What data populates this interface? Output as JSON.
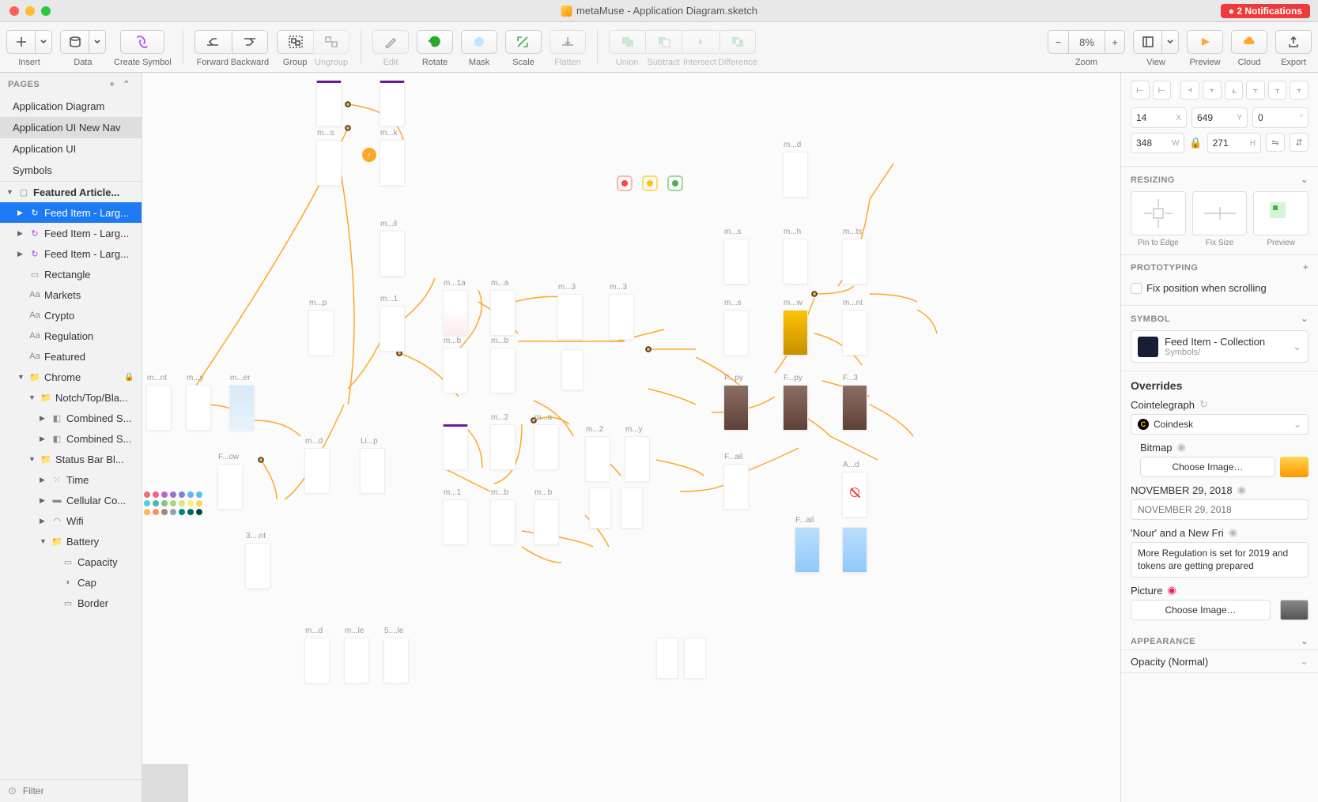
{
  "titlebar": {
    "filename": "metaMuse - Application Diagram.sketch",
    "notifications": "2 Notifications"
  },
  "toolbar": {
    "insert": "Insert",
    "data": "Data",
    "create_symbol": "Create Symbol",
    "forward": "Forward",
    "backward": "Backward",
    "group": "Group",
    "ungroup": "Ungroup",
    "edit": "Edit",
    "rotate": "Rotate",
    "mask": "Mask",
    "scale": "Scale",
    "flatten": "Flatten",
    "union": "Union",
    "subtract": "Subtract",
    "intersect": "Intersect",
    "difference": "Difference",
    "zoom": "Zoom",
    "zoom_value": "8%",
    "view": "View",
    "preview": "Preview",
    "cloud": "Cloud",
    "export": "Export"
  },
  "pages": {
    "header": "PAGES",
    "items": [
      {
        "label": "Application Diagram",
        "selected": false
      },
      {
        "label": "Application UI New Nav",
        "selected": true
      },
      {
        "label": "Application UI",
        "selected": false
      },
      {
        "label": "Symbols",
        "selected": false
      }
    ]
  },
  "layers": [
    {
      "depth": 1,
      "arrow": "open",
      "icon": "artboard",
      "label": "Featured Article...",
      "selected": false
    },
    {
      "depth": 2,
      "arrow": "open",
      "icon": "symbol-p",
      "label": "Feed Item - Larg...",
      "selected": true
    },
    {
      "depth": 2,
      "arrow": "closed",
      "icon": "symbol-o",
      "label": "Feed Item - Larg...",
      "selected": false
    },
    {
      "depth": 2,
      "arrow": "closed",
      "icon": "symbol-o",
      "label": "Feed Item - Larg...",
      "selected": false
    },
    {
      "depth": 2,
      "arrow": "none",
      "icon": "rect",
      "label": "Rectangle",
      "selected": false
    },
    {
      "depth": 2,
      "arrow": "none",
      "icon": "text",
      "label": "Markets",
      "selected": false
    },
    {
      "depth": 2,
      "arrow": "none",
      "icon": "text",
      "label": "Crypto",
      "selected": false
    },
    {
      "depth": 2,
      "arrow": "none",
      "icon": "text",
      "label": "Regulation",
      "selected": false
    },
    {
      "depth": 2,
      "arrow": "none",
      "icon": "text",
      "label": "Featured",
      "selected": false
    },
    {
      "depth": 2,
      "arrow": "open",
      "icon": "folder",
      "label": "Chrome",
      "selected": false,
      "locked": true
    },
    {
      "depth": 3,
      "arrow": "open",
      "icon": "folder",
      "label": "Notch/Top/Bla...",
      "selected": false
    },
    {
      "depth": 4,
      "arrow": "closed",
      "icon": "shape",
      "label": "Combined S...",
      "selected": false
    },
    {
      "depth": 4,
      "arrow": "closed",
      "icon": "shape",
      "label": "Combined S...",
      "selected": false
    },
    {
      "depth": 3,
      "arrow": "open",
      "icon": "folder",
      "label": "Status Bar Bl...",
      "selected": false
    },
    {
      "depth": 4,
      "arrow": "closed",
      "icon": "text-b",
      "label": "Time",
      "selected": false
    },
    {
      "depth": 4,
      "arrow": "closed",
      "icon": "shape",
      "label": "Cellular Co...",
      "selected": false
    },
    {
      "depth": 4,
      "arrow": "closed",
      "icon": "wifi",
      "label": "Wifi",
      "selected": false
    },
    {
      "depth": 4,
      "arrow": "open",
      "icon": "folder",
      "label": "Battery",
      "selected": false
    },
    {
      "depth": 5,
      "arrow": "none",
      "icon": "rect",
      "label": "Capacity",
      "selected": false
    },
    {
      "depth": 5,
      "arrow": "none",
      "icon": "shape",
      "label": "Cap",
      "selected": false
    },
    {
      "depth": 5,
      "arrow": "none",
      "icon": "rect",
      "label": "Border",
      "selected": false
    }
  ],
  "filter": {
    "placeholder": "Filter"
  },
  "inspector": {
    "position": {
      "x": "14",
      "y": "649",
      "r": "0"
    },
    "size": {
      "w": "348",
      "h": "271"
    },
    "resizing": {
      "header": "RESIZING",
      "pin": "Pin to Edge",
      "fix": "Fix Size",
      "preview": "Preview"
    },
    "prototyping": {
      "header": "PROTOTYPING",
      "fix_scroll": "Fix position when scrolling"
    },
    "symbol": {
      "header": "SYMBOL",
      "name": "Feed Item - Collection",
      "path": "Symbols/"
    },
    "overrides": {
      "header": "Overrides",
      "label1": "Cointelegraph",
      "value1": "Coindesk",
      "bitmap_label": "Bitmap",
      "choose_image": "Choose Image…",
      "date_label": "NOVEMBER 29, 2018",
      "date_placeholder": "NOVEMBER 29, 2018",
      "title_label": "'Nour' and a New Fri",
      "title_value": "More Regulation is set for 2019 and tokens are getting prepared",
      "picture_label": "Picture"
    },
    "appearance": {
      "header": "APPEARANCE",
      "opacity": "Opacity (Normal)"
    }
  },
  "canvas_labels": {
    "ms1": "m...s",
    "mk": "m...k",
    "md1": "m...d",
    "mnt1": "m...nt",
    "my1": "m...y",
    "mer": "m...er",
    "mp": "m...p",
    "mil": "m...il",
    "m1": "m...1",
    "m1a": "m...1a",
    "ma1": "m...a",
    "m3a": "m...3",
    "m3b": "m...3",
    "mb1": "m...b",
    "mb2": "m...b",
    "ms2": "m...s",
    "mh": "m...h",
    "mts": "m...ts",
    "ms3": "m...s",
    "mw": "m...w",
    "mnt2": "m...nt",
    "fpy1": "F...py",
    "fpy2": "F...py",
    "f3": "F...3",
    "md2": "m...d",
    "lip": "Li...p",
    "m1b": "m...1",
    "mb3": "m...b",
    "mb4": "m...b",
    "m2a": "m...2",
    "ma2": "m...a",
    "m2b": "m...2",
    "my2": "m...y",
    "fail": "F...ail",
    "ad": "A...d",
    "fow": "F...ow",
    "fail2": "F...ail",
    "threent": "3....nt",
    "md3": "m...d",
    "mle1": "m...le",
    "fivele": "5....le"
  }
}
